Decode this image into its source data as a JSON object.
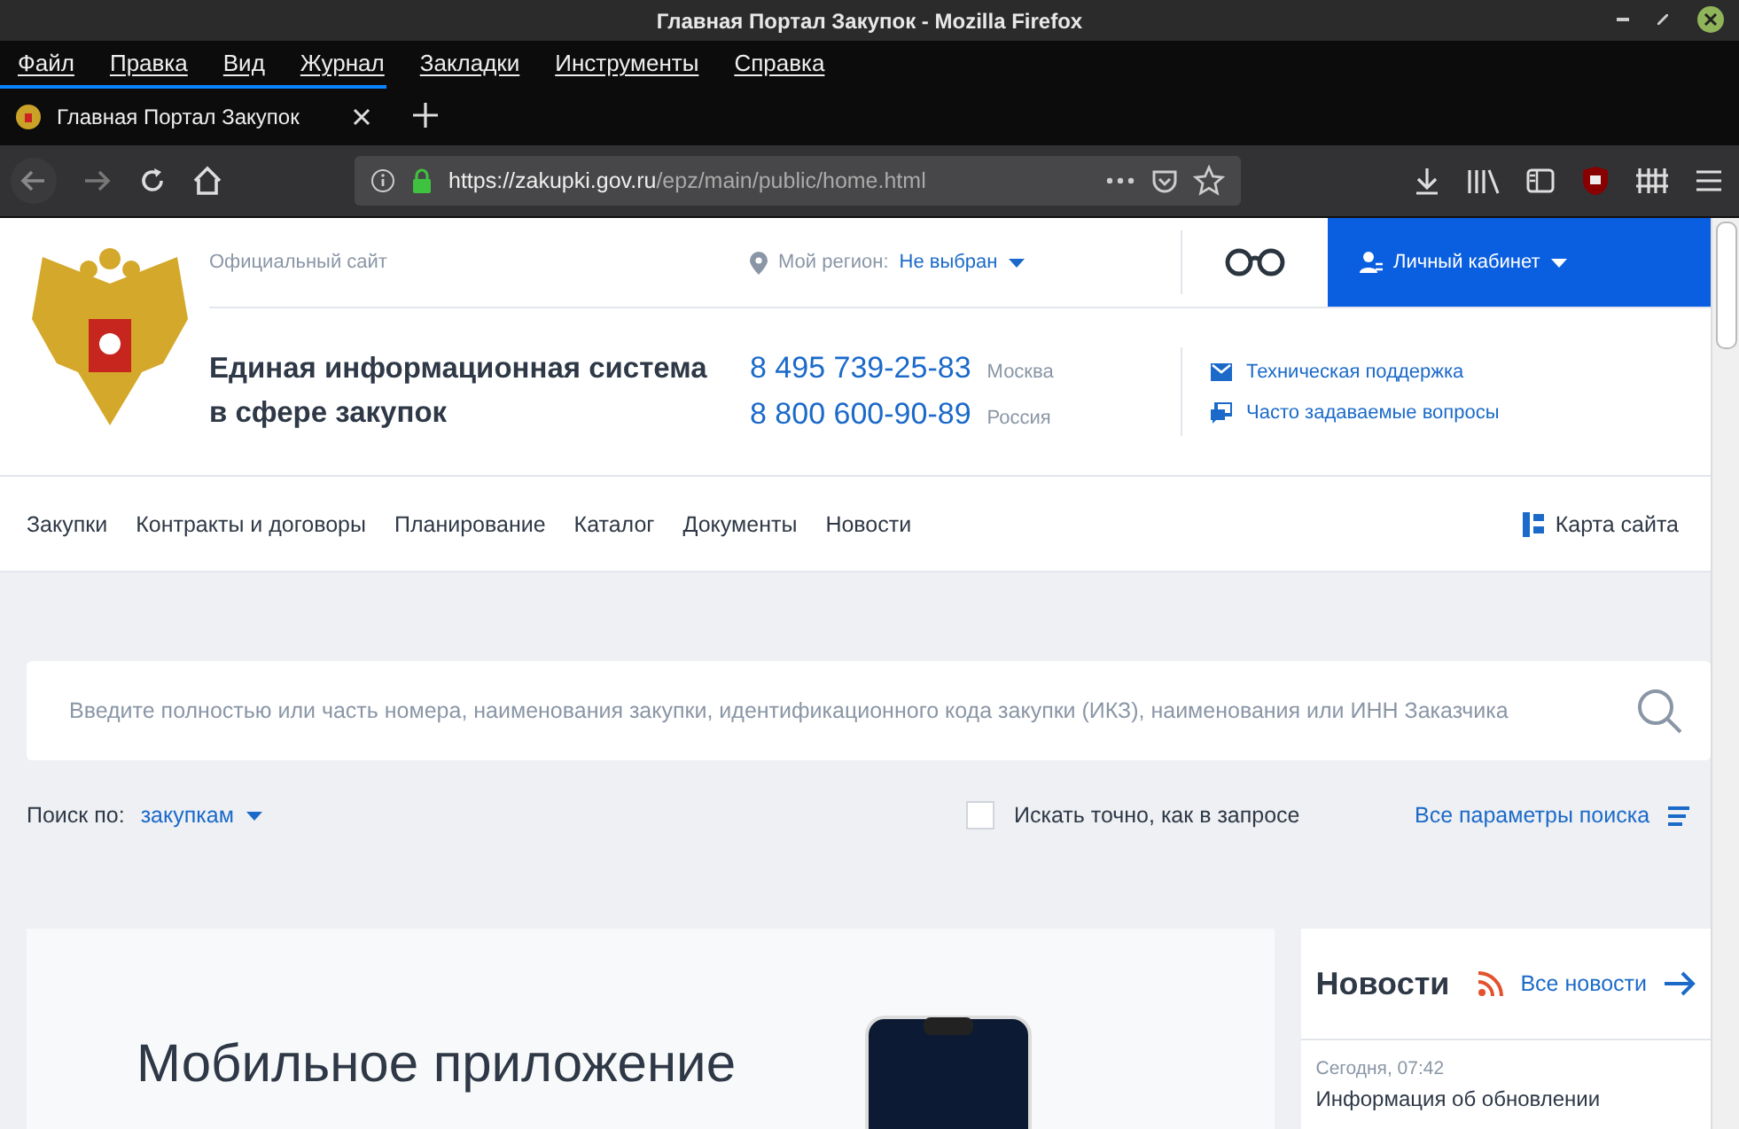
{
  "window": {
    "title": "Главная Портал Закупок - Mozilla Firefox"
  },
  "menu_bar": [
    "Файл",
    "Правка",
    "Вид",
    "Журнал",
    "Закладки",
    "Инструменты",
    "Справка"
  ],
  "tabs": [
    {
      "label": "Главная Портал Закупок",
      "selected": true
    }
  ],
  "address_bar": {
    "domain": "https://zakupki.gov.ru",
    "path": "/epz/main/public/home.html"
  },
  "header": {
    "official": "Официальный сайт",
    "region_label": "Мой регион:",
    "region_value": "Не выбран",
    "account": "Личный кабинет",
    "title": "Единая информационная система в сфере закупок",
    "phones": [
      {
        "number": "8 495 739-25-83",
        "city": "Москва"
      },
      {
        "number": "8 800 600-90-89",
        "city": "Россия"
      }
    ],
    "links": [
      {
        "kind": "mail",
        "label": "Техническая поддержка"
      },
      {
        "kind": "faq",
        "label": "Часто задаваемые вопросы"
      }
    ]
  },
  "nav": {
    "items": [
      "Закупки",
      "Контракты и договоры",
      "Планирование",
      "Каталог",
      "Документы",
      "Новости"
    ],
    "sitemap": "Карта сайта"
  },
  "search": {
    "placeholder": "Введите полностью или часть номера, наименования закупки, идентификационного кода закупки (ИКЗ), наименования или ИНН Заказчика",
    "by_label": "Поиск по:",
    "by_value": "закупкам",
    "exact": {
      "label": "Искать точно, как в запросе",
      "checked": false
    },
    "all_params": "Все параметры поиска"
  },
  "promo": {
    "title": "Мобильное приложение"
  },
  "news": {
    "title": "Новости",
    "all": "Все новости",
    "items": [
      {
        "date": "Сегодня, 07:42",
        "text": "Информация об обновлении"
      }
    ]
  }
}
